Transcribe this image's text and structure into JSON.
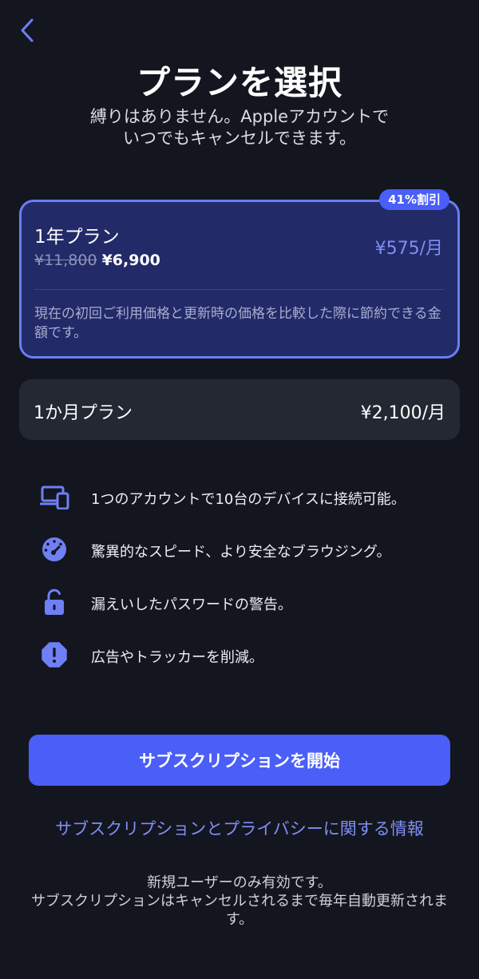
{
  "header": {
    "title": "プランを選択",
    "subtitle_line1": "縛りはありません。Appleアカウントで",
    "subtitle_line2": "いつでもキャンセルできます。"
  },
  "plans": {
    "yearly": {
      "badge": "41%割引",
      "name": "1年プラン",
      "old_price": "¥11,800",
      "new_price": "¥6,900",
      "monthly_price": "¥575/月",
      "note": "現在の初回ご利用価格と更新時の価格を比較した際に節約できる金額です。",
      "selected": true
    },
    "monthly": {
      "name": "1か月プラン",
      "price": "¥2,100/月",
      "selected": false
    }
  },
  "features": [
    {
      "icon": "devices-icon",
      "text": "1つのアカウントで10台のデバイスに接続可能。"
    },
    {
      "icon": "speedometer-icon",
      "text": "驚異的なスピード、より安全なブラウジング。"
    },
    {
      "icon": "unlocked-padlock-icon",
      "text": "漏えいしたパスワードの警告。"
    },
    {
      "icon": "warning-octagon-icon",
      "text": "広告やトラッカーを削減。"
    }
  ],
  "cta": {
    "label": "サブスクリプションを開始"
  },
  "links": {
    "privacy": "サブスクリプションとプライバシーに関する情報"
  },
  "footer": {
    "line1": "新規ユーザーのみ有効です。",
    "line2": "サブスクリプションはキャンセルされるまで毎年自動更新されます。"
  },
  "colors": {
    "background": "#13161e",
    "accent": "#4a5ef8",
    "accent_light": "#7f8ef5",
    "selected_card": "#222a68",
    "card": "#242833"
  }
}
